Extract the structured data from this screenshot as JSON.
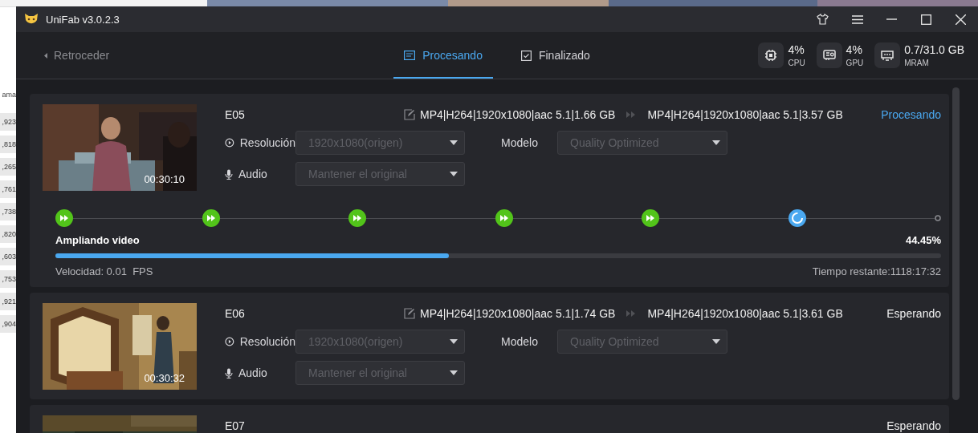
{
  "background_app": {
    "column_header": "ama",
    "cells": [
      ",923",
      ",818",
      ",265",
      ",761",
      ",738",
      ",820",
      ",603",
      ",753",
      ",921",
      ",904"
    ]
  },
  "window": {
    "title": "UniFab v3.0.2.3"
  },
  "nav": {
    "back": "Retroceder",
    "tabs": [
      {
        "label": "Procesando",
        "selected": true
      },
      {
        "label": "Finalizado",
        "selected": false
      }
    ]
  },
  "stats": [
    {
      "kind": "cpu",
      "value": "4%",
      "label": "CPU"
    },
    {
      "kind": "gpu",
      "value": "4%",
      "label": "GPU"
    },
    {
      "kind": "ram",
      "value": "0.7/31.0 GB",
      "label": "MRAM"
    }
  ],
  "tasks": [
    {
      "name": "E05",
      "source": "MP4|H264|1920x1080|aac 5.1|1.66 GB",
      "target": "MP4|H264|1920x1080|aac 5.1|3.57 GB",
      "status": "Procesando",
      "processing": true,
      "duration": "00:30:10",
      "resolution_label": "Resolución",
      "resolution": "1920x1080(origen)",
      "model_label": "Modelo",
      "model": "Quality Optimized",
      "audio_label": "Audio",
      "audio": "Mantener el original",
      "progress": {
        "steps": [
          {
            "done": true,
            "active": false
          },
          {
            "done": true,
            "active": false
          },
          {
            "done": true,
            "active": false
          },
          {
            "done": true,
            "active": false
          },
          {
            "done": true,
            "active": false
          },
          {
            "done": false,
            "active": true
          },
          {
            "done": false,
            "active": false
          }
        ],
        "stage": "Ampliando video",
        "percent": "44.45%",
        "level": 0.4445,
        "speed": "Velocidad: 0.01  FPS",
        "remaining": "Tiempo restante:1118:17:32"
      }
    },
    {
      "name": "E06",
      "source": "MP4|H264|1920x1080|aac 5.1|1.74 GB",
      "target": "MP4|H264|1920x1080|aac 5.1|3.61 GB",
      "status": "Esperando",
      "processing": false,
      "duration": "00:30:32",
      "resolution_label": "Resolución",
      "resolution": "1920x1080(origen)",
      "model_label": "Modelo",
      "model": "Quality Optimized",
      "audio_label": "Audio",
      "audio": "Mantener el original"
    },
    {
      "name": "E07",
      "status": "Esperando",
      "processing": false
    }
  ]
}
